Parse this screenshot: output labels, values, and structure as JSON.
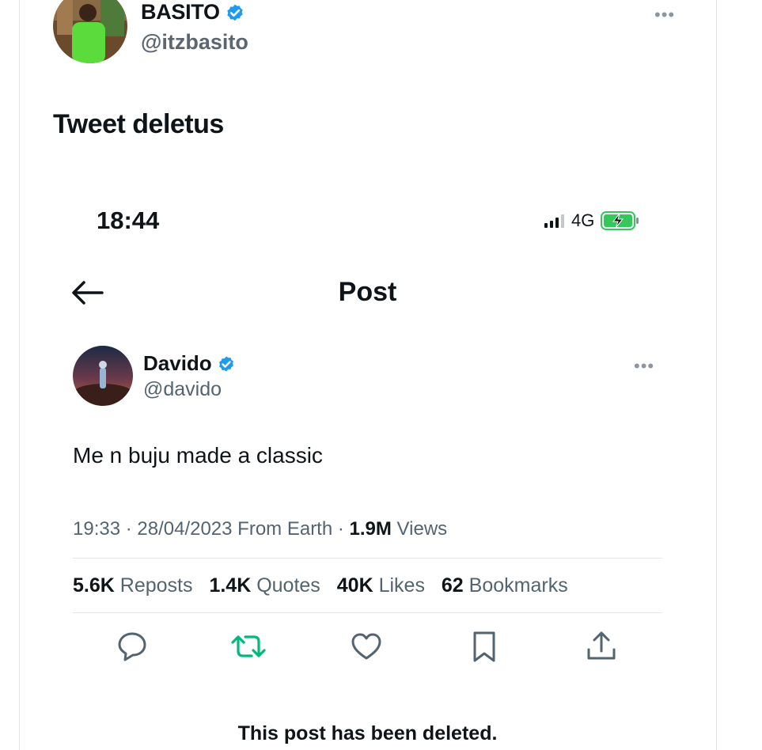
{
  "outer_tweet": {
    "author_name": "BASITO",
    "author_handle": "@itzbasito",
    "more_label": "•••",
    "text": "Tweet deletus"
  },
  "status_bar": {
    "time": "18:44",
    "network": "4G"
  },
  "post_header": {
    "title": "Post"
  },
  "inner_post": {
    "author_name": "Davido",
    "author_handle": "@davido",
    "more_label": "•••",
    "text": "Me n buju made a classic",
    "timestamp": "19:33 · 28/04/2023 From Earth · ",
    "views_count": "1.9M",
    "views_label": " Views",
    "stats": [
      {
        "count": "5.6K",
        "label": " Reposts"
      },
      {
        "count": "1.4K",
        "label": " Quotes"
      },
      {
        "count": "40K",
        "label": " Likes"
      },
      {
        "count": "62",
        "label": " Bookmarks"
      }
    ],
    "actions": [
      "reply-icon",
      "repost-icon",
      "like-icon",
      "bookmark-icon",
      "share-icon"
    ]
  },
  "deleted_notice": "This post has been deleted.",
  "colors": {
    "verified": "#1d9bf0",
    "repost_green": "#00ba7c",
    "battery_green": "#34c759",
    "secondary_text": "#536471"
  }
}
